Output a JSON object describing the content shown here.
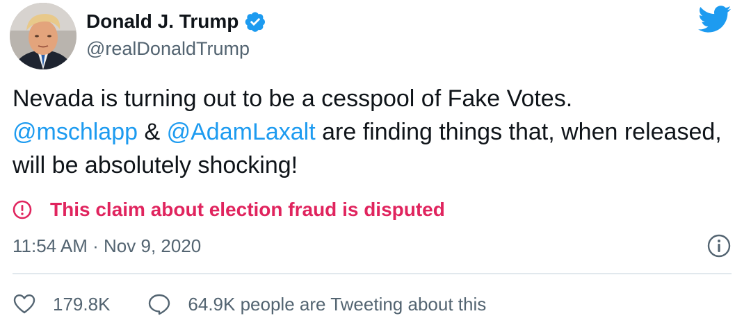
{
  "author": {
    "display_name": "Donald J. Trump",
    "handle": "@realDonaldTrump",
    "verified": true
  },
  "tweet": {
    "text_part1": "Nevada is turning out to be a cesspool of Fake Votes.",
    "mention1": "@mschlapp",
    "connector": " & ",
    "mention2": "@AdamLaxalt",
    "text_part2": " are finding things that, when released, will be absolutely shocking!",
    "warning": "This claim about election fraud is disputed",
    "timestamp": "11:54 AM · Nov 9, 2020"
  },
  "actions": {
    "like_count": "179.8K",
    "reply_text": "64.9K people are Tweeting about this"
  },
  "colors": {
    "brand_blue": "#1d9bf0",
    "warning_red": "#e0245e",
    "secondary_text": "#536471"
  },
  "icons": {
    "logo": "twitter-bird-icon",
    "verified": "verified-badge-icon",
    "warning": "exclamation-circle-icon",
    "info": "info-circle-icon",
    "like": "heart-icon",
    "reply": "speech-bubble-icon"
  }
}
